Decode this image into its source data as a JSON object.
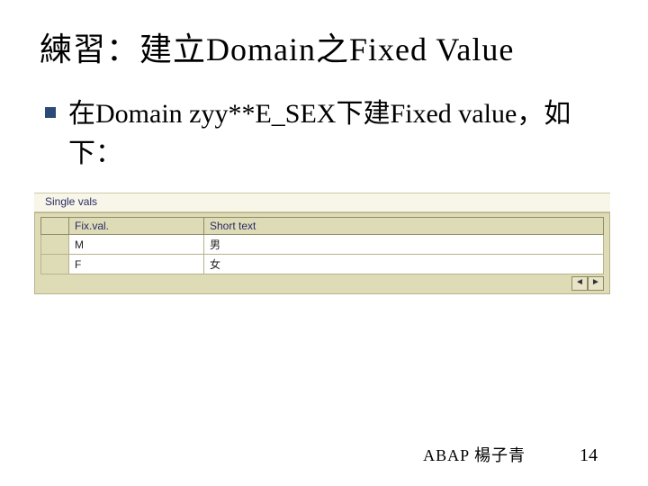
{
  "title": "練習：建立Domain之Fixed Value",
  "body": "在Domain zyy**E_SEX下建Fixed value，如下：",
  "sap": {
    "section_label": "Single vals",
    "columns": {
      "fix": "Fix.val.",
      "short": "Short text"
    },
    "rows": [
      {
        "fix": "M",
        "short": "男"
      },
      {
        "fix": "F",
        "short": "女"
      }
    ],
    "scroll_left": "◄",
    "scroll_right": "►"
  },
  "footer": {
    "author": "ABAP 楊子青",
    "page": "14"
  }
}
